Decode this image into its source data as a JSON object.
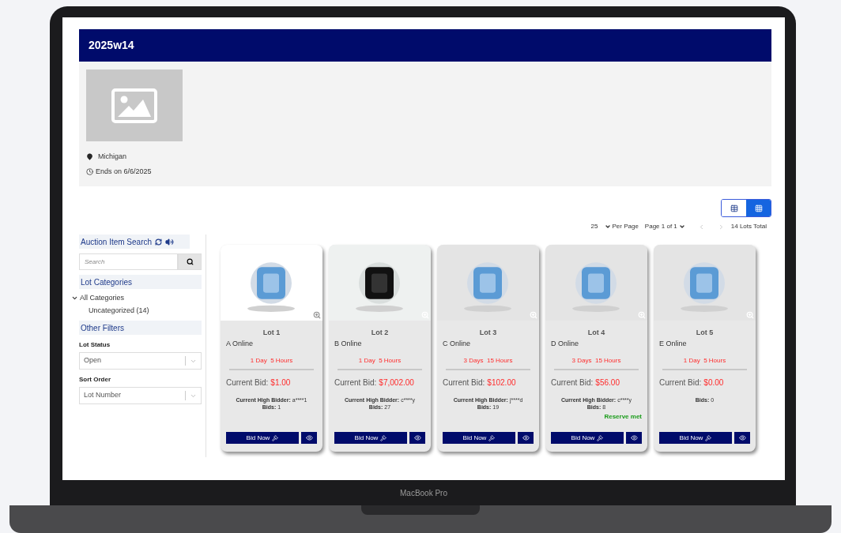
{
  "auction": {
    "title": "2025w14",
    "location": "Michigan",
    "ends": "Ends on 6/6/2025"
  },
  "view_toggle": [
    {
      "kind": "list",
      "selected": false
    },
    {
      "kind": "grid",
      "selected": true
    }
  ],
  "pagination": {
    "per_page_value": "25",
    "per_page_label": "Per Page",
    "page": "Page 1 of 1",
    "total": "14 Lots Total"
  },
  "sidebar": {
    "search_title": "Auction Item Search",
    "search_placeholder": "Search",
    "categories_title": "Lot Categories",
    "categories": [
      {
        "label": "All Categories",
        "expanded": true,
        "children": [
          {
            "label": "Uncategorized (14)"
          }
        ]
      }
    ],
    "filters_title": "Other Filters",
    "filters": [
      {
        "label": "Lot Status",
        "value": "Open"
      },
      {
        "label": "Sort Order",
        "value": "Lot Number"
      }
    ]
  },
  "lots": [
    {
      "lot": "Lot 1",
      "title": "A Online",
      "time_left": "1 Day  5 Hours",
      "bid_label": "Current Bid:",
      "bid": "$1.00",
      "high_bidder_label": "Current High Bidder:",
      "high_bidder": "a****1",
      "bids_label": "Bids:",
      "bids": "1",
      "bid_button": "Bid Now"
    },
    {
      "lot": "Lot 2",
      "title": "B Online",
      "time_left": "1 Day  5 Hours",
      "bid_label": "Current Bid:",
      "bid": "$7,002.00",
      "high_bidder_label": "Current High Bidder:",
      "high_bidder": "c****y",
      "bids_label": "Bids:",
      "bids": "27",
      "bid_button": "Bid Now"
    },
    {
      "lot": "Lot 3",
      "title": "C Online",
      "time_left": "3 Days  15 Hours",
      "bid_label": "Current Bid:",
      "bid": "$102.00",
      "high_bidder_label": "Current High Bidder:",
      "high_bidder": "j****d",
      "bids_label": "Bids:",
      "bids": "19",
      "bid_button": "Bid Now"
    },
    {
      "lot": "Lot 4",
      "title": "D Online",
      "time_left": "3 Days  15 Hours",
      "bid_label": "Current Bid:",
      "bid": "$56.00",
      "high_bidder_label": "Current High Bidder:",
      "high_bidder": "c****y",
      "bids_label": "Bids:",
      "bids": "8",
      "reserve": "Reserve met",
      "bid_button": "Bid Now"
    },
    {
      "lot": "Lot 5",
      "title": "E Online",
      "time_left": "1 Day  5 Hours",
      "bid_label": "Current Bid:",
      "bid": "$0.00",
      "bids_label": "Bids:",
      "bids": "0",
      "bid_button": "Bid Now"
    }
  ],
  "device": {
    "label": "MacBook Pro"
  }
}
